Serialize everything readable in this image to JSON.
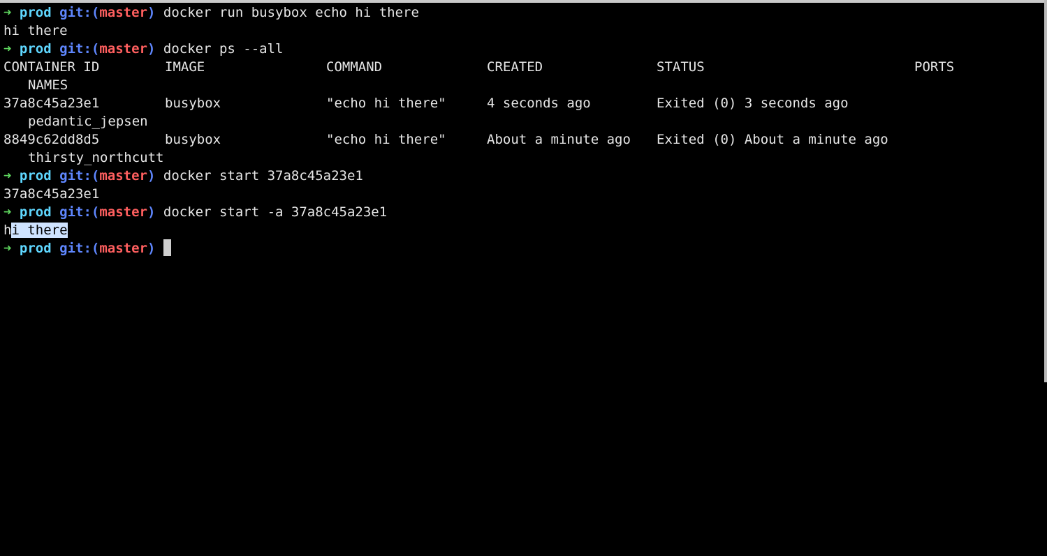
{
  "prompt": {
    "arrow": "➜",
    "dir": "prod",
    "git_open": "git:(",
    "branch": "master",
    "git_close": ")"
  },
  "lines": {
    "cmd1": "docker run busybox echo hi there",
    "out1": "hi there",
    "cmd2": "docker ps --all",
    "cmd3": "docker start 37a8c45a23e1",
    "out3": "37a8c45a23e1",
    "cmd4": "docker start -a 37a8c45a23e1",
    "out4_h": "h",
    "out4_rest": "i there"
  },
  "table": {
    "headers": [
      "CONTAINER ID",
      "IMAGE",
      "COMMAND",
      "CREATED",
      "STATUS",
      "PORTS",
      "NAMES"
    ],
    "rows": [
      {
        "container_id": "37a8c45a23e1",
        "image": "busybox",
        "command": "\"echo hi there\"",
        "created": "4 seconds ago",
        "status": "Exited (0) 3 seconds ago",
        "ports": "",
        "names": "pedantic_jepsen"
      },
      {
        "container_id": "8849c62dd8d5",
        "image": "busybox",
        "command": "\"echo hi there\"",
        "created": "About a minute ago",
        "status": "Exited (0) About a minute ago",
        "ports": "",
        "names": "thirsty_northcutt"
      }
    ]
  },
  "colors": {
    "background": "#000000",
    "arrow": "#5fd75f",
    "dir": "#5fd7ff",
    "git": "#5f87ff",
    "branch": "#ff5f5f",
    "text": "#e6e6e6",
    "selection": "#cfe3ff"
  }
}
